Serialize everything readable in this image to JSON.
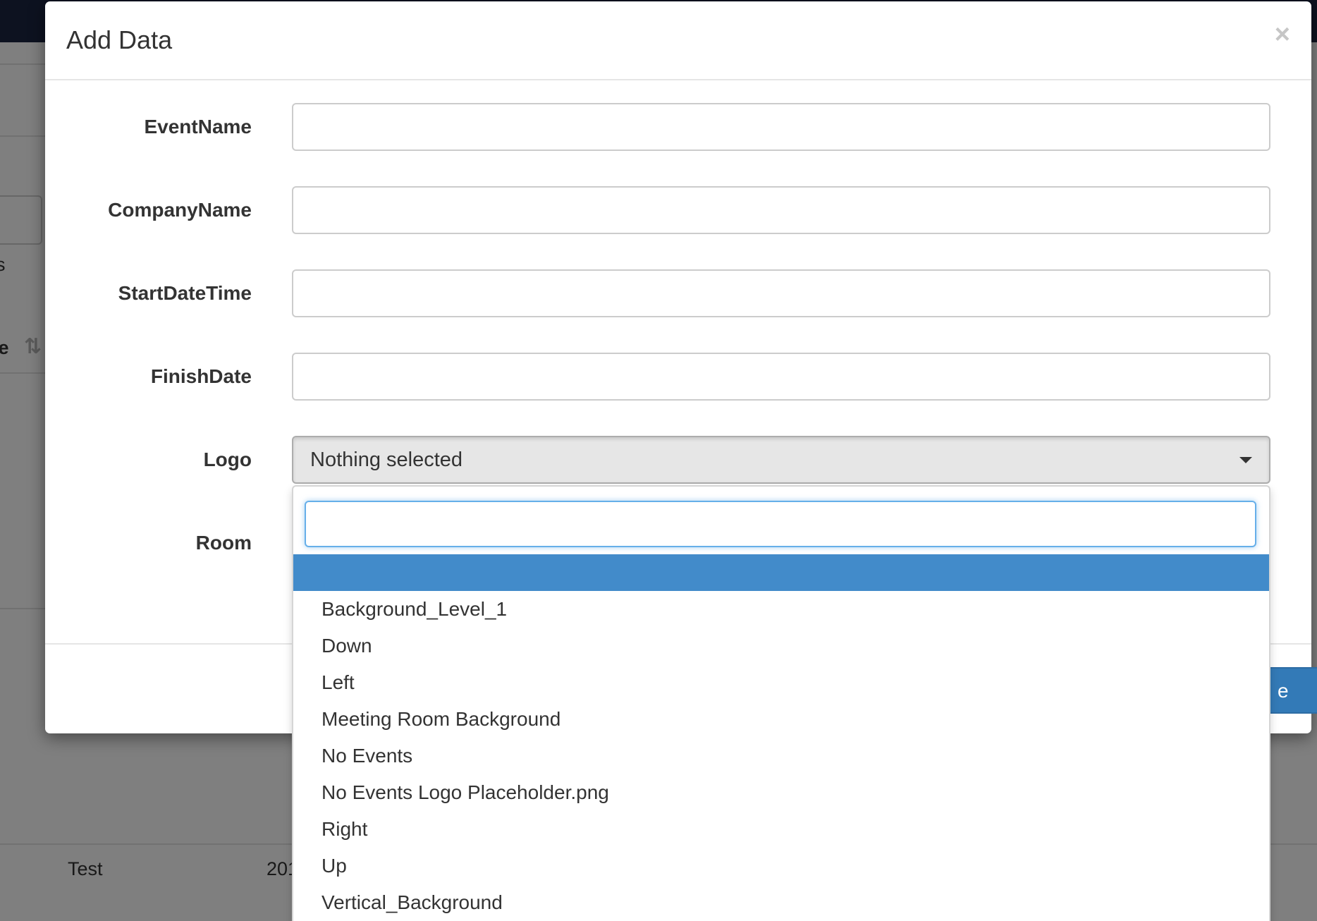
{
  "background_page": {
    "fragment_s": "s",
    "fragment_header": "le",
    "row": {
      "name": "Test",
      "date_fragment": "201"
    }
  },
  "modal": {
    "title": "Add Data",
    "close_symbol": "×",
    "fields": [
      {
        "label": "EventName",
        "value": ""
      },
      {
        "label": "CompanyName",
        "value": ""
      },
      {
        "label": "StartDateTime",
        "value": ""
      },
      {
        "label": "FinishDate",
        "value": ""
      }
    ],
    "logo": {
      "label": "Logo",
      "selected_text": "Nothing selected"
    },
    "room": {
      "label": "Room"
    },
    "save_button": {
      "label_fragment": "e",
      "color": "#337ab7"
    }
  },
  "dropdown": {
    "search_value": "",
    "highlight_color": "#428bca",
    "options": [
      "",
      "Background_Level_1",
      "Down",
      "Left",
      "Meeting Room Background",
      "No Events",
      "No Events Logo Placeholder.png",
      "Right",
      "Up",
      "Vertical_Background"
    ]
  }
}
